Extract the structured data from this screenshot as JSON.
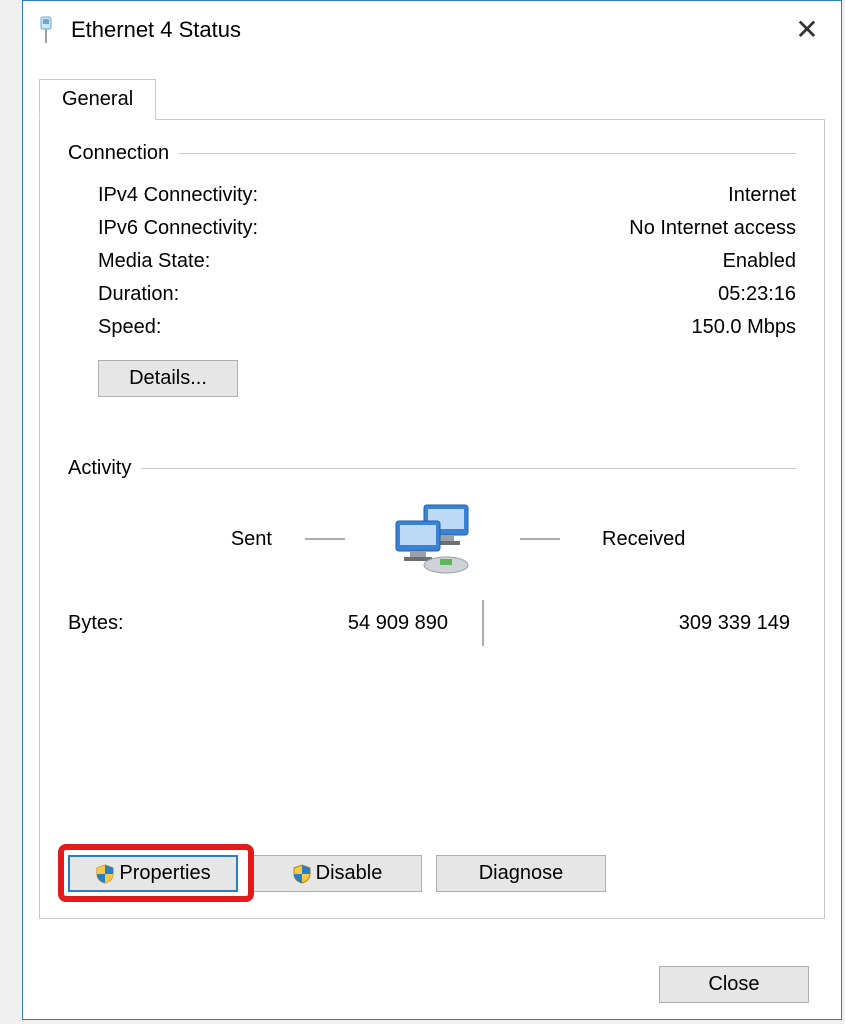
{
  "window": {
    "title": "Ethernet 4 Status",
    "close_x": "✕"
  },
  "tabs": {
    "general": "General"
  },
  "connection": {
    "header": "Connection",
    "rows": [
      {
        "label": "IPv4 Connectivity:",
        "value": "Internet"
      },
      {
        "label": "IPv6 Connectivity:",
        "value": "No Internet access"
      },
      {
        "label": "Media State:",
        "value": "Enabled"
      },
      {
        "label": "Duration:",
        "value": "05:23:16"
      },
      {
        "label": "Speed:",
        "value": "150.0 Mbps"
      }
    ],
    "details_button": "Details..."
  },
  "activity": {
    "header": "Activity",
    "sent_label": "Sent",
    "received_label": "Received",
    "bytes_label": "Bytes:",
    "bytes_sent": "54 909 890",
    "bytes_received": "309 339 149"
  },
  "buttons": {
    "properties": "Properties",
    "disable": "Disable",
    "diagnose": "Diagnose",
    "close": "Close"
  }
}
